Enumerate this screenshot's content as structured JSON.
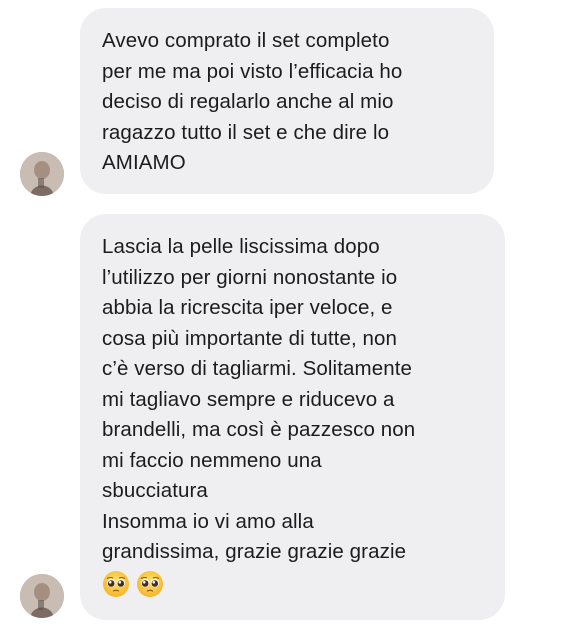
{
  "messages": [
    {
      "text": "Avevo comprato il set completo\nper me ma poi visto l’efficacia ho\ndeciso di regalarlo anche al mio\nragazzo tutto il set e che dire lo\nAMIAMO"
    },
    {
      "text": "Lascia la pelle liscissima dopo\nl’utilizzo per giorni nonostante io\nabbia la ricrescita iper veloce, e\ncosa più importante di tutte, non\nc’è verso di tagliarmi. Solitamente\nmi tagliavo sempre e riducevo a\nbrandelli, ma così è pazzesco non\nmi faccio nemmeno una\nsbucciatura\nInsomma io vi amo alla\ngrandissima, grazie grazie grazie",
      "emojis": [
        "pleading-face-emoji",
        "pleading-face-emoji"
      ]
    }
  ],
  "colors": {
    "bubble": "#efeff1",
    "text": "#1c1c1e"
  }
}
